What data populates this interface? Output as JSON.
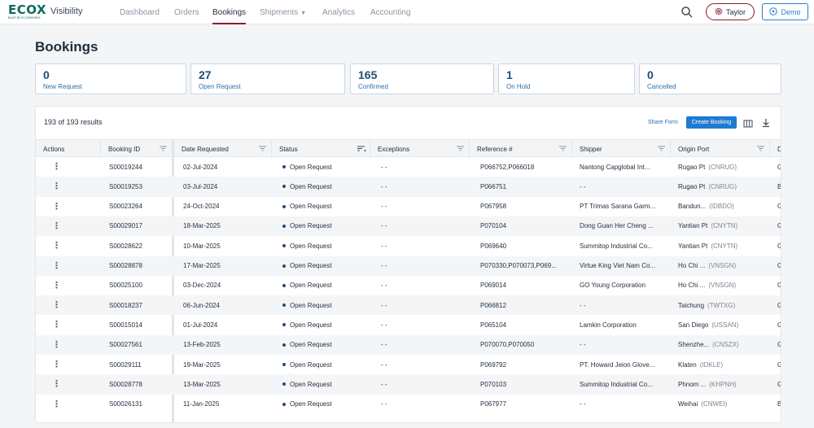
{
  "brand": {
    "logo": "ECOX",
    "logo_sub": "BUILT BY ECOSPHERES",
    "app_name": "Visibility"
  },
  "nav": {
    "items": [
      {
        "label": "Dashboard",
        "active": false
      },
      {
        "label": "Orders",
        "active": false
      },
      {
        "label": "Bookings",
        "active": true
      },
      {
        "label": "Shipments",
        "active": false,
        "dropdown": true
      },
      {
        "label": "Analytics",
        "active": false
      },
      {
        "label": "Accounting",
        "active": false
      }
    ],
    "search_icon": "search-icon",
    "user_label": "Taylor",
    "user_icon": "gear-icon",
    "demo_label": "Demo",
    "demo_icon": "play-circle-icon"
  },
  "page": {
    "title": "Bookings"
  },
  "stats": [
    {
      "value": "0",
      "label": "New Request"
    },
    {
      "value": "27",
      "label": "Open Request"
    },
    {
      "value": "165",
      "label": "Confirmed"
    },
    {
      "value": "1",
      "label": "On Hold"
    },
    {
      "value": "0",
      "label": "Cancelled"
    }
  ],
  "toolbar": {
    "results": "193 of 193 results",
    "share_form": "Share Form",
    "create_booking": "Create Booking",
    "columns_icon": "columns-icon",
    "download_icon": "download-icon"
  },
  "table": {
    "headers": [
      "Actions",
      "Booking ID",
      "Date Requested",
      "Status",
      "Exceptions",
      "Reference #",
      "Shipper",
      "Origin Port",
      "D"
    ],
    "rows": [
      {
        "id": "S00019244",
        "date": "02-Jul-2024",
        "status": "Open Request",
        "exceptions": "- -",
        "ref": "P066752,P066018",
        "shipper": "Nantong Capglobal Int...",
        "port": "Rugao Pt",
        "code": "(CNRUG)",
        "d": "G"
      },
      {
        "id": "S00019253",
        "date": "03-Jul-2024",
        "status": "Open Request",
        "exceptions": "- -",
        "ref": "P066751",
        "shipper": "- -",
        "port": "Rugao Pt",
        "code": "(CNRUG)",
        "d": "B"
      },
      {
        "id": "S00023264",
        "date": "24-Oct-2024",
        "status": "Open Request",
        "exceptions": "- -",
        "ref": "P067958",
        "shipper": "PT Trimas Sarana Garm...",
        "port": "Bandun...",
        "code": "(IDBDO)",
        "d": "G"
      },
      {
        "id": "S00029017",
        "date": "18-Mar-2025",
        "status": "Open Request",
        "exceptions": "- -",
        "ref": "P070104",
        "shipper": "Dong Guan Her Cheng ...",
        "port": "Yantian Pt",
        "code": "(CNYTN)",
        "d": "G"
      },
      {
        "id": "S00028622",
        "date": "10-Mar-2025",
        "status": "Open Request",
        "exceptions": "- -",
        "ref": "P069640",
        "shipper": "Summitop Industrial Co...",
        "port": "Yantian Pt",
        "code": "(CNYTN)",
        "d": "G"
      },
      {
        "id": "S00028878",
        "date": "17-Mar-2025",
        "status": "Open Request",
        "exceptions": "- -",
        "ref": "P070330,P070073,P069...",
        "shipper": "Virtue King Viet Nam Co...",
        "port": "Ho Chi ...",
        "code": "(VNSGN)",
        "d": "G"
      },
      {
        "id": "S00025100",
        "date": "03-Dec-2024",
        "status": "Open Request",
        "exceptions": "- -",
        "ref": "P069014",
        "shipper": "GO Young Corporation",
        "port": "Ho Chi ...",
        "code": "(VNSGN)",
        "d": "G"
      },
      {
        "id": "S00018237",
        "date": "06-Jun-2024",
        "status": "Open Request",
        "exceptions": "- -",
        "ref": "P066812",
        "shipper": "- -",
        "port": "Taichung",
        "code": "(TWTXG)",
        "d": "G"
      },
      {
        "id": "S00015014",
        "date": "01-Jul-2024",
        "status": "Open Request",
        "exceptions": "- -",
        "ref": "P065104",
        "shipper": "Lamkin Corporation",
        "port": "San Diego",
        "code": "(USSAN)",
        "d": "G"
      },
      {
        "id": "S00027561",
        "date": "13-Feb-2025",
        "status": "Open Request",
        "exceptions": "- -",
        "ref": "P070070,P070050",
        "shipper": "- -",
        "port": "Shenzhe...",
        "code": "(CNSZX)",
        "d": "G"
      },
      {
        "id": "S00029111",
        "date": "19-Mar-2025",
        "status": "Open Request",
        "exceptions": "- -",
        "ref": "P069792",
        "shipper": "PT. Howard Jeion Glove...",
        "port": "Klaten",
        "code": "(IDKLE)",
        "d": "G"
      },
      {
        "id": "S00028778",
        "date": "13-Mar-2025",
        "status": "Open Request",
        "exceptions": "- -",
        "ref": "P070103",
        "shipper": "Summitop Industrial Co...",
        "port": "Phnom ...",
        "code": "(KHPNH)",
        "d": "G"
      },
      {
        "id": "S00026131",
        "date": "11-Jan-2025",
        "status": "Open Request",
        "exceptions": "- -",
        "ref": "P067977",
        "shipper": "- -",
        "port": "Weihai",
        "code": "(CNWEI)",
        "d": "B"
      }
    ]
  },
  "colors": {
    "brand": "#0d6b5e",
    "accent": "#8a1c2c",
    "link": "#2d6fb0",
    "primary_button": "#1f7ad1"
  }
}
